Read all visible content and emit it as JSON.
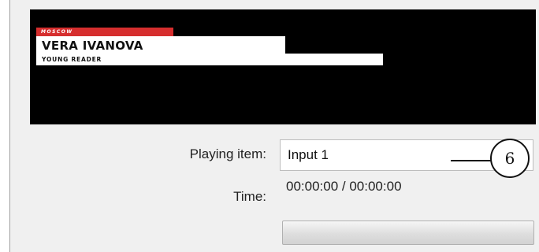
{
  "preview": {
    "lower_third": {
      "tag": "MOSCOW",
      "name": "VERA IVANOVA",
      "subtitle": "YOUNG READER"
    }
  },
  "playing_item": {
    "label": "Playing item:",
    "value": "Input 1"
  },
  "time": {
    "label": "Time:",
    "value": "00:00:00 / 00:00:00"
  },
  "progress": {
    "fraction": 0
  },
  "callout": {
    "number": "6"
  },
  "colors": {
    "preview_bg": "#000000",
    "tag_red": "#d62e2e",
    "panel_bg": "#f0f0f0"
  }
}
